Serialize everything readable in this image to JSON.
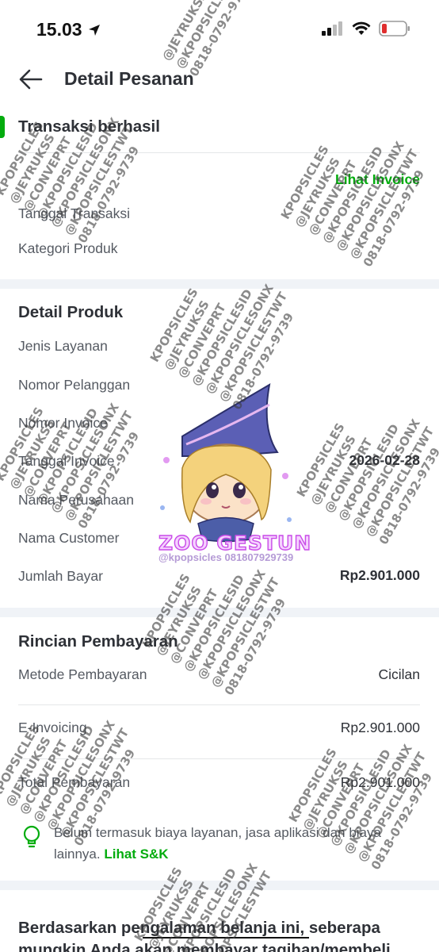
{
  "status_bar": {
    "time": "15.03"
  },
  "header": {
    "title": "Detail Pesanan"
  },
  "order_status": {
    "text": "Transaksi berhasil",
    "invoice_link": "Lihat Invoice"
  },
  "summary": [
    {
      "label": "Tanggal Transaksi",
      "value": ""
    },
    {
      "label": "Kategori Produk",
      "value": ""
    }
  ],
  "product_detail": {
    "title": "Detail Produk",
    "rows": [
      {
        "label": "Jenis Layanan",
        "value": ""
      },
      {
        "label": "Nomor Pelanggan",
        "value": ""
      },
      {
        "label": "Nomor Invoice",
        "value": ""
      },
      {
        "label": "Tanggal Invoice",
        "value": "2026-02-28"
      },
      {
        "label": "Nama Perusahaan",
        "value": ""
      },
      {
        "label": "Nama Customer",
        "value": ""
      },
      {
        "label": "Jumlah Bayar",
        "value": "Rp2.901.000"
      }
    ]
  },
  "payment_detail": {
    "title": "Rincian Pembayaran",
    "rows": [
      {
        "label": "Metode Pembayaran",
        "value": "Cicilan"
      },
      {
        "label": "E-Invoicing",
        "value": "Rp2.901.000"
      },
      {
        "label": "Total Pembayaran",
        "value": "Rp2.901.000"
      }
    ]
  },
  "note": {
    "text": "Belum termasuk biaya layanan, jasa aplikasi dan biaya lainnya.",
    "link": "Lihat S&K"
  },
  "survey": {
    "text": "Berdasarkan pengalaman belanja ini, seberapa mungkin Anda akan membayar tagihan/membeli"
  },
  "sticker": {
    "caption": "ZOO GESTUN",
    "sub": "@kpopsicles 081807929739"
  },
  "watermark": {
    "lines": [
      "KPOPSICLES",
      "@JEYRUKSS",
      "@CONVEPRT",
      "@KPOPSICLESID",
      "@KPOPSICLESONX",
      "@KPOPSICLESTWT",
      "0818-0792-9739"
    ]
  },
  "colors": {
    "accent": "#03ac0e",
    "text": "#2e3137",
    "muted": "#555a62",
    "separator": "#f0f3f7"
  }
}
